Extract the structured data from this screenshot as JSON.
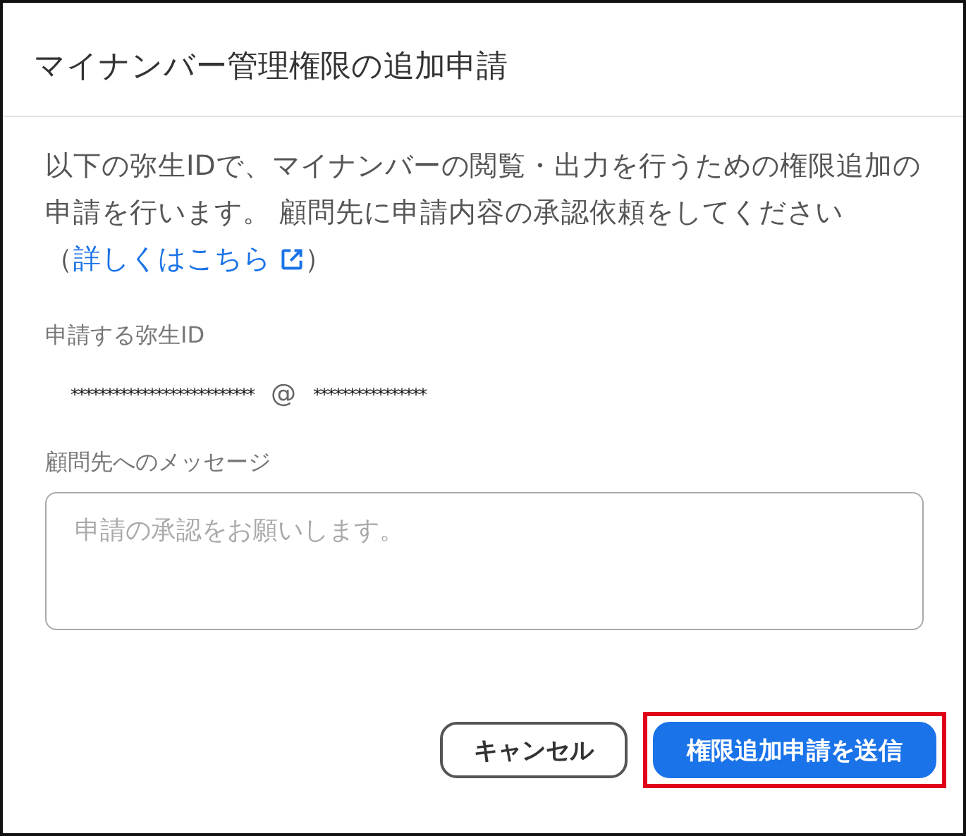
{
  "dialog": {
    "title": "マイナンバー管理権限の追加申請"
  },
  "description": {
    "text": "以下の弥生IDで、マイナンバーの閲覧・出力を行うための権限追加の申請を行います。 顧問先に申請内容の承認依頼をしてください（",
    "link": "詳しくはこちら",
    "after": "）"
  },
  "id_field": {
    "label": "申請する弥生ID",
    "user": "**************************",
    "at": "@",
    "domain": "****************"
  },
  "message_field": {
    "label": "顧問先へのメッセージ",
    "placeholder": "申請の承認をお願いします。"
  },
  "buttons": [
    {
      "label": "キャンセル",
      "kind": "secondary",
      "highlighted": false
    },
    {
      "label": "権限追加申請を送信",
      "kind": "primary",
      "highlighted": true
    }
  ]
}
